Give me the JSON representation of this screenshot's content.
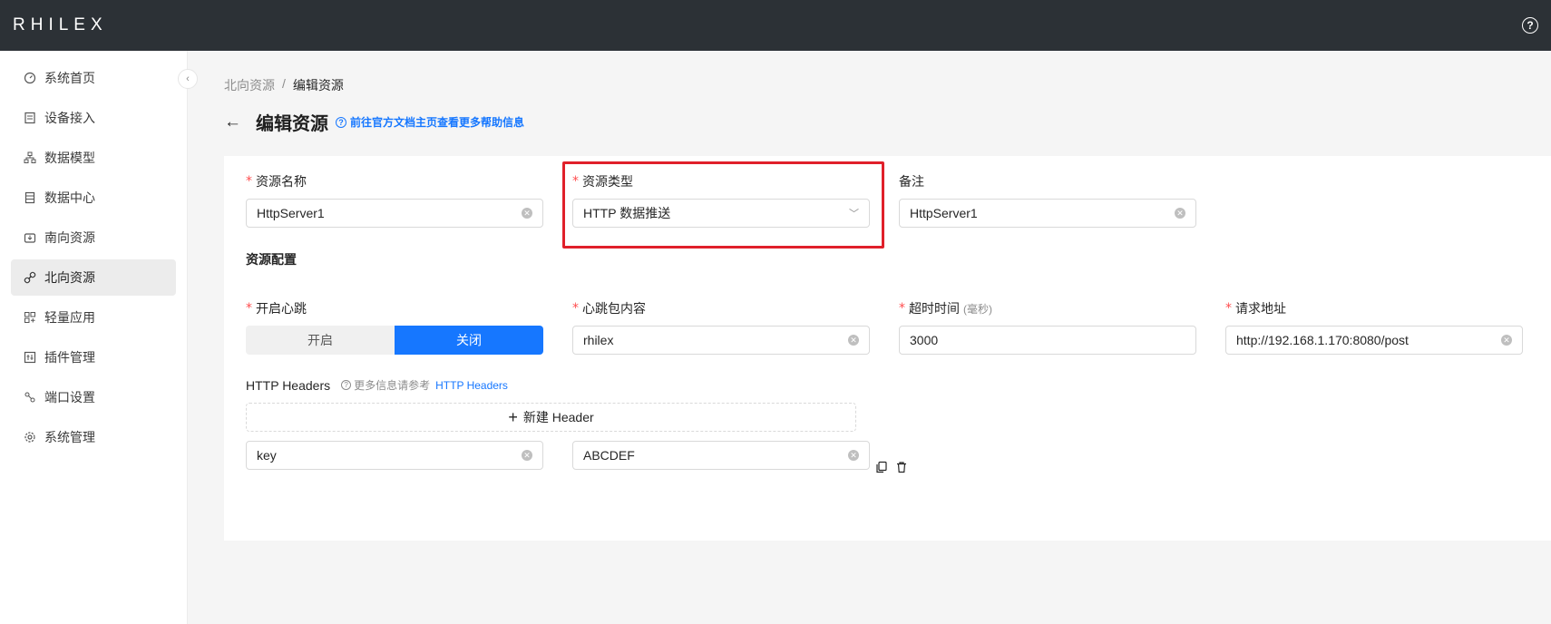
{
  "header": {
    "logo": "RHILEX",
    "help_icon": "question-circle-icon"
  },
  "sidebar": {
    "items": [
      {
        "label": "系统首页",
        "icon": "dashboard-icon",
        "active": false
      },
      {
        "label": "设备接入",
        "icon": "device-icon",
        "active": false
      },
      {
        "label": "数据模型",
        "icon": "model-icon",
        "active": false
      },
      {
        "label": "数据中心",
        "icon": "database-icon",
        "active": false
      },
      {
        "label": "南向资源",
        "icon": "inbox-icon",
        "active": false
      },
      {
        "label": "北向资源",
        "icon": "link-icon",
        "active": true
      },
      {
        "label": "轻量应用",
        "icon": "apps-icon",
        "active": false
      },
      {
        "label": "插件管理",
        "icon": "plugin-icon",
        "active": false
      },
      {
        "label": "端口设置",
        "icon": "port-icon",
        "active": false
      },
      {
        "label": "系统管理",
        "icon": "settings-icon",
        "active": false
      }
    ],
    "collapse_icon": "chevron-left-icon"
  },
  "breadcrumb": {
    "parent": "北向资源",
    "separator": "/",
    "current": "编辑资源"
  },
  "page": {
    "title": "编辑资源",
    "help_link": "前往官方文档主页查看更多帮助信息"
  },
  "form": {
    "name": {
      "label": "资源名称",
      "value": "HttpServer1",
      "required": true
    },
    "type": {
      "label": "资源类型",
      "value": "HTTP 数据推送",
      "required": true
    },
    "remark": {
      "label": "备注",
      "value": "HttpServer1",
      "required": false
    },
    "config_section": "资源配置",
    "heartbeat": {
      "label": "开启心跳",
      "options": [
        "开启",
        "关闭"
      ],
      "selected": "关闭",
      "required": true
    },
    "heartbeat_content": {
      "label": "心跳包内容",
      "value": "rhilex",
      "required": true
    },
    "timeout": {
      "label": "超时时间",
      "unit": "(毫秒)",
      "value": "3000",
      "required": true
    },
    "url": {
      "label": "请求地址",
      "value": "http://192.168.1.170:8080/post",
      "required": true
    },
    "headers": {
      "label": "HTTP Headers",
      "hint": "更多信息请参考",
      "link": "HTTP Headers",
      "add_button": "新建 Header",
      "rows": [
        {
          "key": "key",
          "value": "ABCDEF"
        }
      ]
    }
  },
  "colors": {
    "accent": "#1677ff",
    "topbar": "#2c3136",
    "highlight": "#e0202a",
    "required": "#ff4d4f"
  }
}
